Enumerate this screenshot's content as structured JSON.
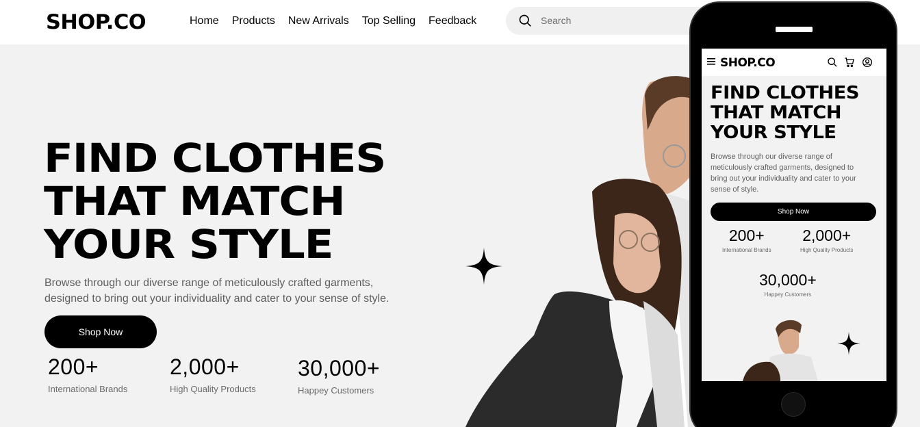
{
  "header": {
    "logo": "SHOP.CO",
    "nav": [
      "Home",
      "Products",
      "New Arrivals",
      "Top Selling",
      "Feedback"
    ],
    "search_placeholder": "Search"
  },
  "hero": {
    "title_lines": [
      "FIND CLOTHES",
      "THAT MATCH",
      "YOUR STYLE"
    ],
    "description_lines": [
      "Browse through our diverse range of meticulously crafted garments,",
      "designed to bring out your individuality and cater to your sense of style."
    ],
    "cta": "Shop Now",
    "stats": [
      {
        "value": "200+",
        "label": "International Brands"
      },
      {
        "value": "2,000+",
        "label": "High Quality Products"
      },
      {
        "value": "30,000+",
        "label": "Happey Customers"
      }
    ]
  },
  "mobile": {
    "logo": "SHOP.CO",
    "title_lines": [
      "FIND CLOTHES",
      "THAT MATCH",
      "YOUR STYLE"
    ],
    "description_lines": [
      "Browse through our diverse range of",
      "meticulously crafted garments, designed to",
      "bring out your individuality and cater to your",
      "sense of style."
    ],
    "cta": "Shop Now",
    "stats": [
      {
        "value": "200+",
        "label": "International Brands"
      },
      {
        "value": "2,000+",
        "label": "High Quality Products"
      },
      {
        "value": "30,000+",
        "label": "Happey Customers"
      }
    ]
  },
  "colors": {
    "brand": "#000000",
    "background": "#f2f2f2",
    "muted_text": "#5e5e5e"
  }
}
